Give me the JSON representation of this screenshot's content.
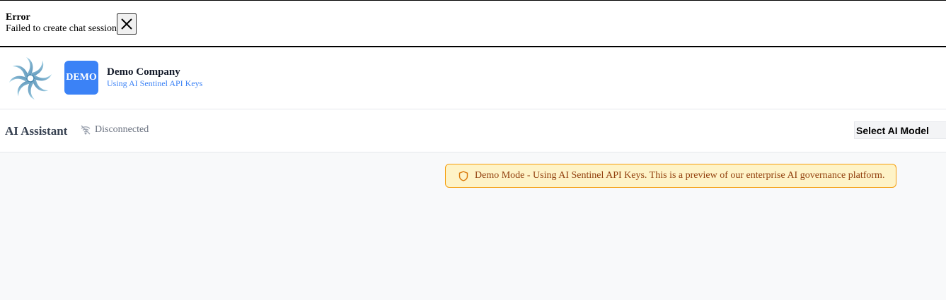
{
  "error": {
    "title": "Error",
    "message": "Failed to create chat session",
    "close_icon": "close-icon"
  },
  "company": {
    "badge": "DEMO",
    "name": "Demo Company",
    "subtitle": "Using AI Sentinel API Keys",
    "logo_icon": "pinwheel-logo"
  },
  "assistant": {
    "title": "AI Assistant",
    "status": "Disconnected",
    "status_icon": "wifi-off-icon",
    "model_select": "Select AI Model"
  },
  "notice": {
    "text": "Demo Mode - Using AI Sentinel API Keys. This is a preview of our enterprise AI governance platform.",
    "icon": "shield-icon"
  },
  "colors": {
    "accent": "#3b82f6",
    "notice_bg": "#fef3c7",
    "notice_border": "#f59e0b",
    "notice_text": "#92400e"
  }
}
